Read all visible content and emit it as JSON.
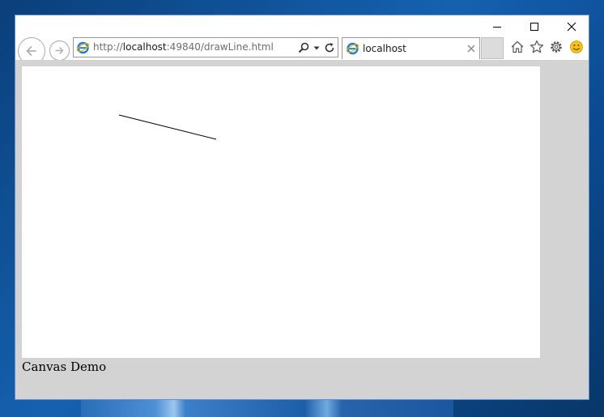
{
  "browser": {
    "address": {
      "scheme": "http://",
      "host": "localhost",
      "rest": ":49840/drawLine.html"
    },
    "tab": {
      "title": "localhost"
    }
  },
  "page": {
    "caption": "Canvas Demo"
  },
  "icons": {
    "window_controls": [
      "minimize-icon",
      "maximize-icon",
      "close-icon"
    ],
    "navigation": [
      "back-arrow-icon",
      "forward-arrow-icon",
      "ie-favicon-icon",
      "search-icon",
      "dropdown-caret-icon",
      "refresh-icon"
    ],
    "toolbar": [
      "home-icon",
      "star-icon",
      "gear-icon",
      "smiley-icon"
    ]
  },
  "colors": {
    "page_background": "#d3d3d3",
    "canvas_background": "#ffffff",
    "stroke": "#000000",
    "window_border": "#5b8fd2"
  }
}
